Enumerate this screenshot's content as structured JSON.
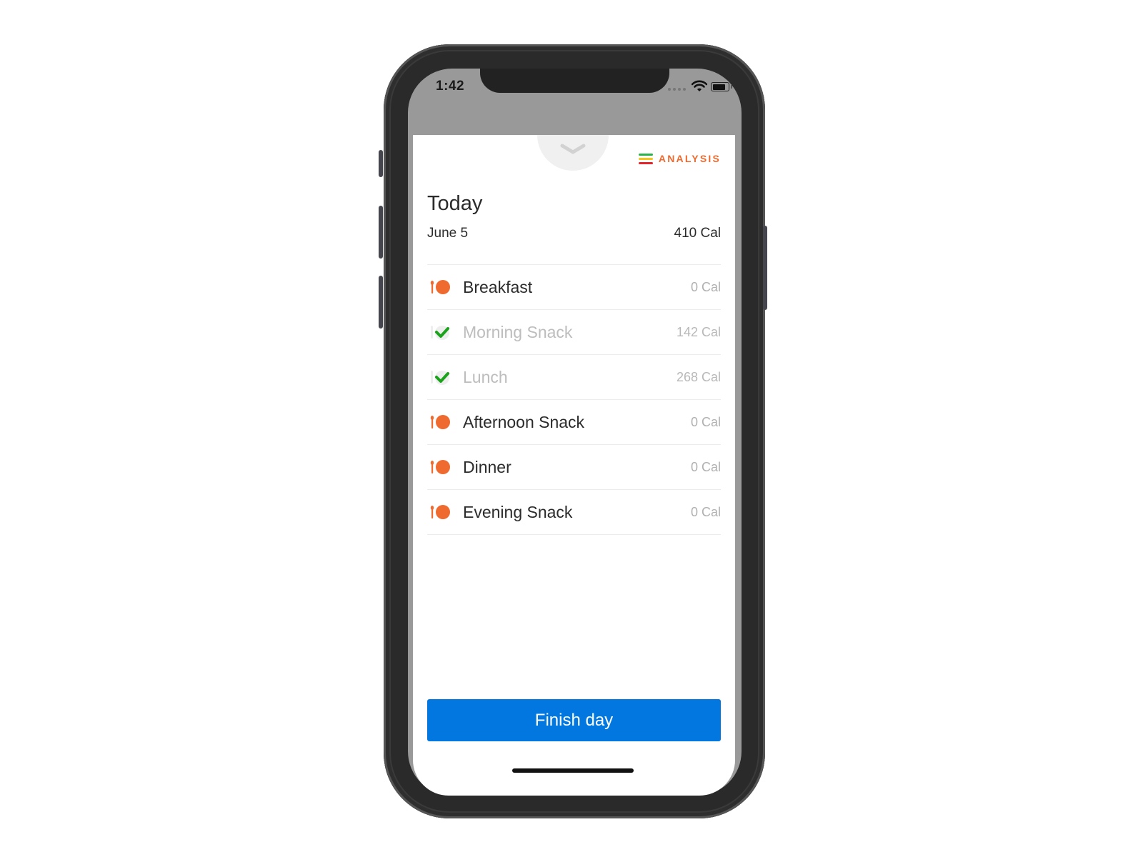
{
  "status_bar": {
    "time": "1:42"
  },
  "header": {
    "analysis_label": "ANALYSIS",
    "analysis_colors": [
      "#2db24a",
      "#f5c518",
      "#e5242a"
    ]
  },
  "day": {
    "title": "Today",
    "date": "June 5",
    "total_calories": "410 Cal"
  },
  "meals": [
    {
      "name": "Breakfast",
      "calories": "0 Cal",
      "logged": false
    },
    {
      "name": "Morning Snack",
      "calories": "142 Cal",
      "logged": true
    },
    {
      "name": "Lunch",
      "calories": "268 Cal",
      "logged": true
    },
    {
      "name": "Afternoon Snack",
      "calories": "0 Cal",
      "logged": false
    },
    {
      "name": "Dinner",
      "calories": "0 Cal",
      "logged": false
    },
    {
      "name": "Evening Snack",
      "calories": "0 Cal",
      "logged": false
    }
  ],
  "icons": {
    "unlogged": "fork-plate-icon",
    "logged": "checkmark-icon",
    "collapse": "chevron-down-icon"
  },
  "colors": {
    "accent": "#ee6a2f",
    "check": "#1aa31a",
    "button": "#0277e0"
  },
  "actions": {
    "finish_label": "Finish day"
  }
}
